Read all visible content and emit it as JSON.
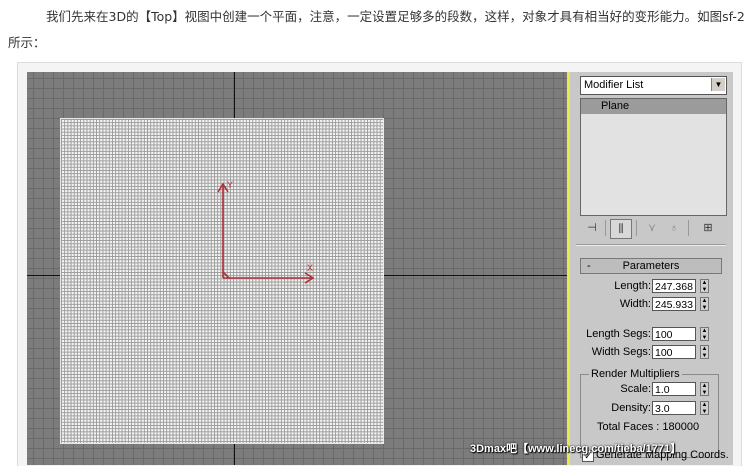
{
  "article": {
    "intro": "我们先来在3D的【Top】视图中创建一个平面，注意，一定设置足够多的段数，这样，对象才具有相当好的变形能力。如图sf-2所示："
  },
  "viewport": {
    "gizmo_x_label": "X",
    "gizmo_y_label": "Y"
  },
  "modifier_panel": {
    "dropdown_value": "Modifier List",
    "stack_items": [
      "Plane"
    ],
    "toolbar_icons": [
      "pin-stack-icon",
      "show-end-result-icon",
      "make-unique-icon",
      "remove-modifier-icon",
      "configure-modifier-sets-icon"
    ]
  },
  "parameters": {
    "title": "Parameters",
    "collapse_symbol": "-",
    "length_label": "Length:",
    "length_value": "247.368",
    "width_label": "Width:",
    "width_value": "245.933",
    "length_segs_label": "Length Segs:",
    "length_segs_value": "100",
    "width_segs_label": "Width Segs:",
    "width_segs_value": "100",
    "render_multipliers_title": "Render Multipliers",
    "scale_label": "Scale:",
    "scale_value": "1.0",
    "density_label": "Density:",
    "density_value": "3.0",
    "total_faces_text": "Total Faces : 180000",
    "generate_mapping_label": "Generate Mapping Coords.",
    "generate_mapping_checked": true
  },
  "watermark": {
    "text": "3Dmax吧【www.linecg.com/tieba/1771】"
  },
  "colors": {
    "viewport_bg": "#7c7c7c",
    "plane_fill": "#f3f3f3",
    "gizmo": "#b0303a",
    "panel_accent": "#e9e94c"
  }
}
